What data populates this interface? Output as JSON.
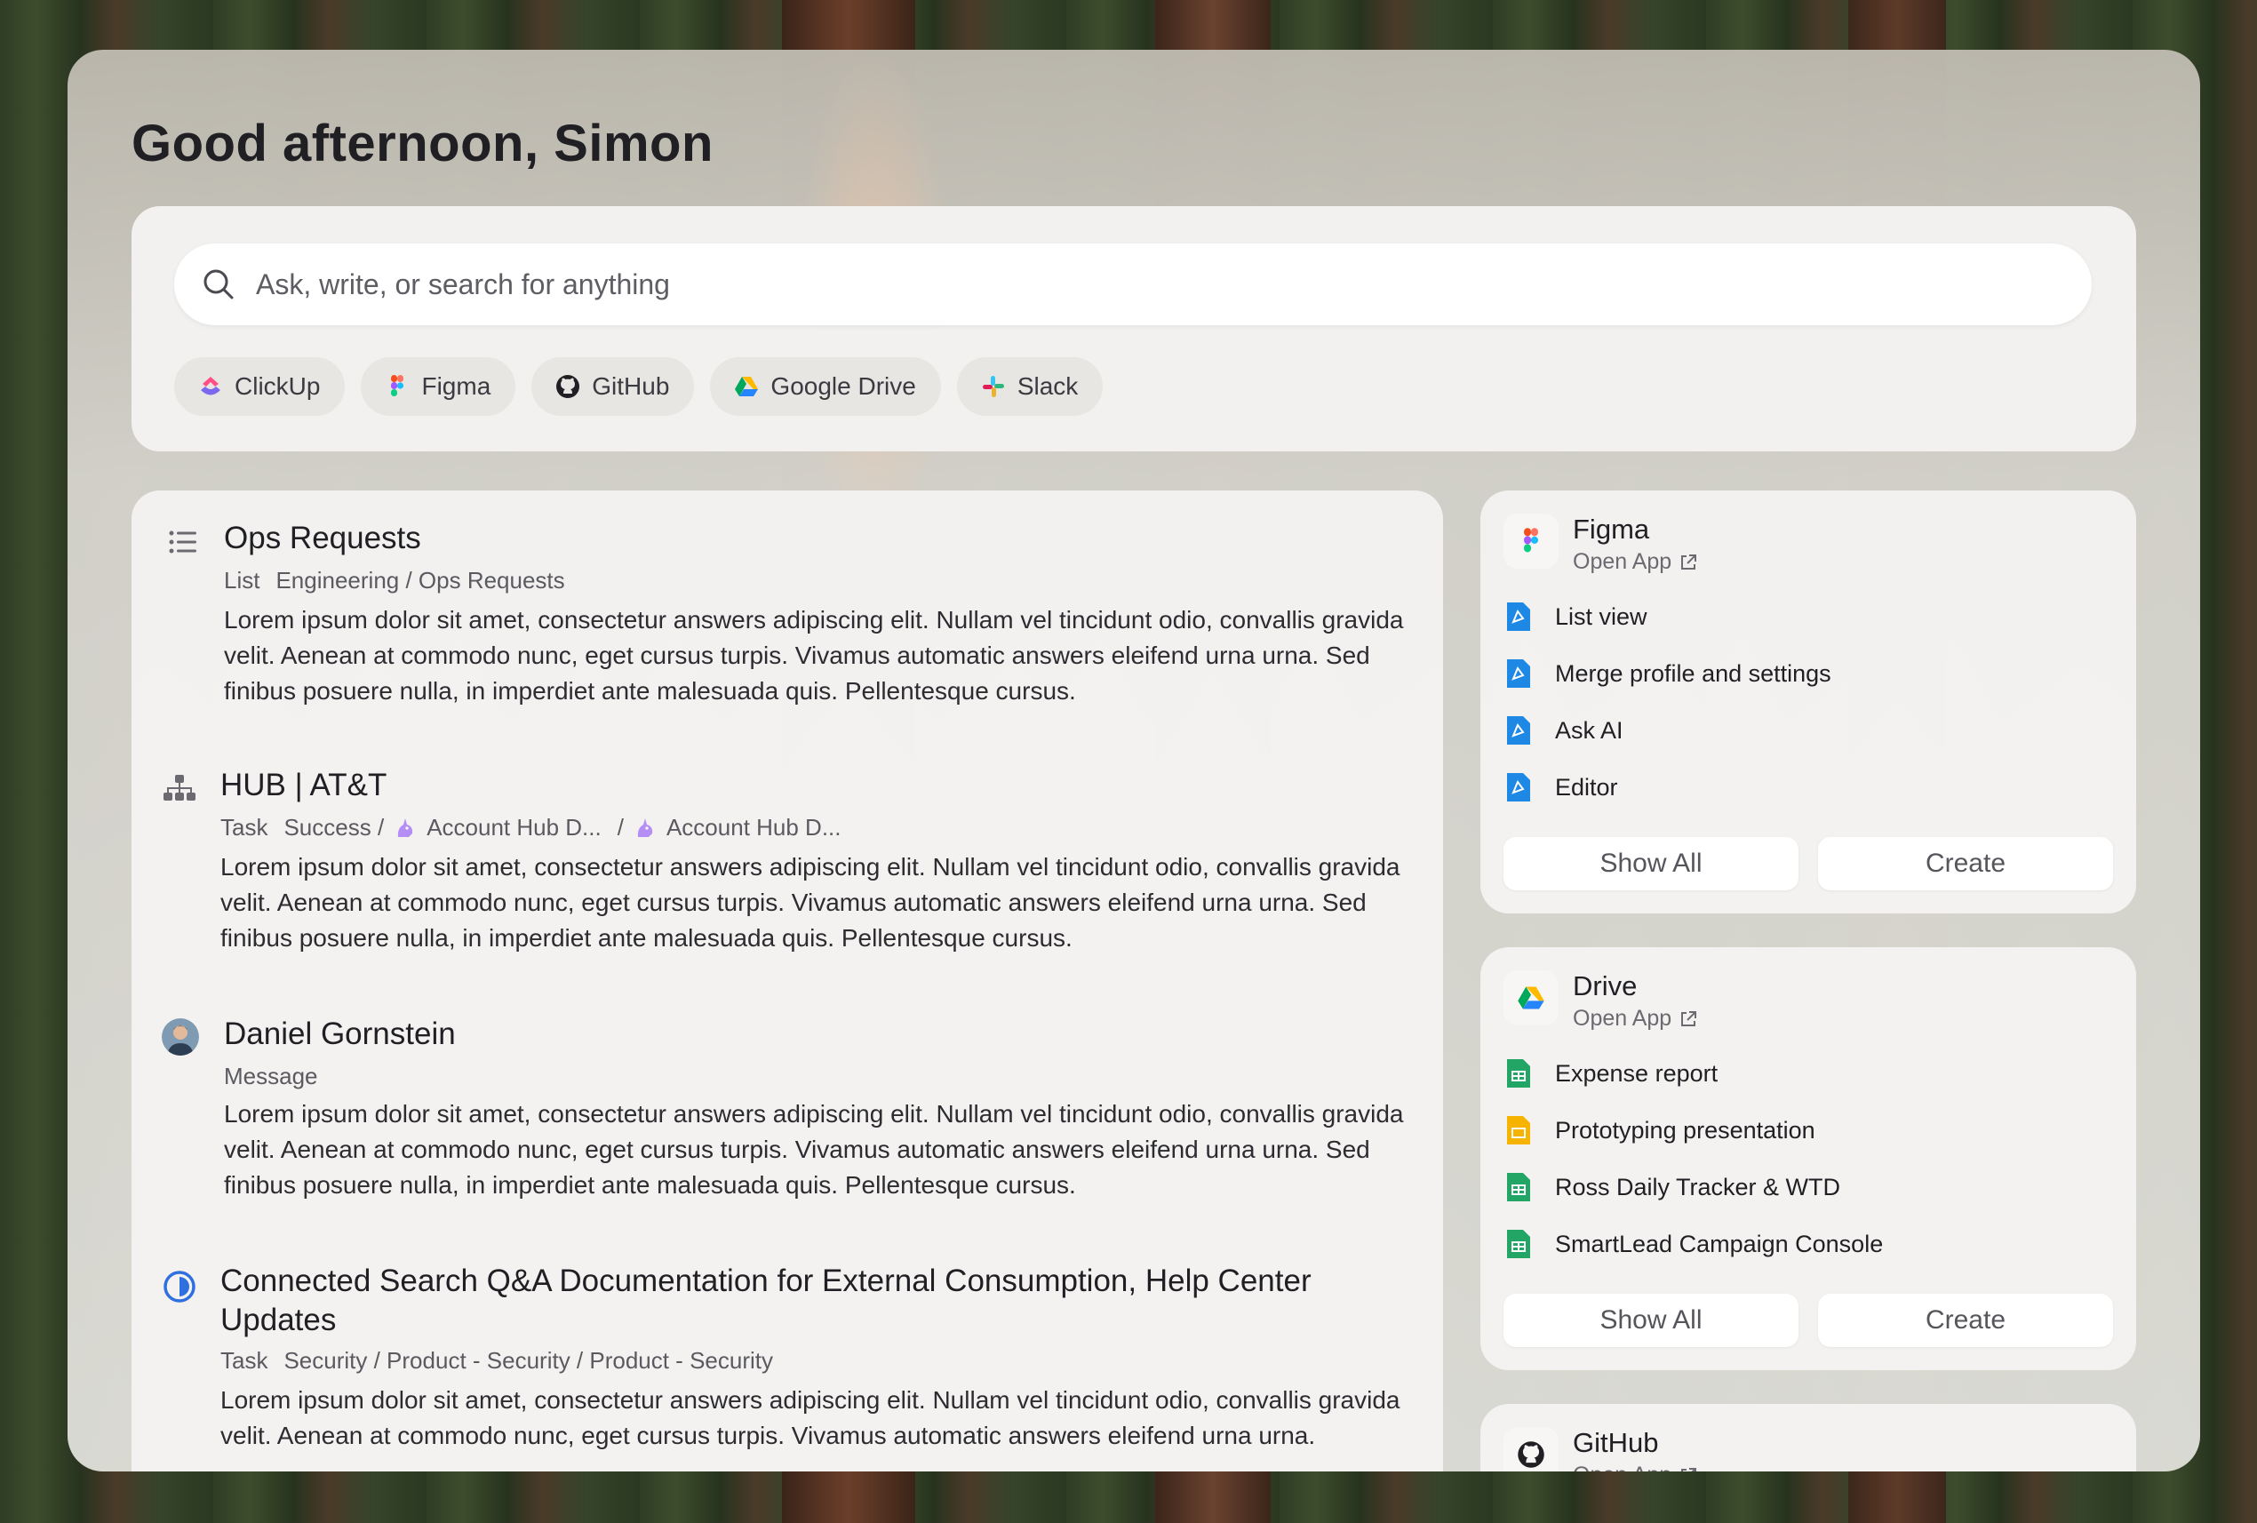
{
  "greeting": "Good afternoon, Simon",
  "search": {
    "placeholder": "Ask, write, or search for anything"
  },
  "chips": [
    {
      "label": "ClickUp",
      "icon": "clickup-icon"
    },
    {
      "label": "Figma",
      "icon": "figma-icon"
    },
    {
      "label": "GitHub",
      "icon": "github-icon"
    },
    {
      "label": "Google Drive",
      "icon": "google-drive-icon"
    },
    {
      "label": "Slack",
      "icon": "slack-icon"
    }
  ],
  "results": [
    {
      "icon": "list-icon",
      "title": "Ops Requests",
      "type": "List",
      "path": "Engineering / Ops Requests",
      "body": "Lorem ipsum dolor sit amet, consectetur answers adipiscing elit. Nullam vel tincidunt odio, convallis gravida velit. Aenean at commodo nunc, eget cursus turpis. Vivamus automatic answers eleifend urna urna. Sed finibus posuere nulla, in imperdiet ante malesuada quis. Pellentesque cursus."
    },
    {
      "icon": "hierarchy-icon",
      "title": "HUB | AT&T",
      "type": "Task",
      "path_start": "Success /",
      "path_a": "Account Hub D...",
      "path_mid": "/",
      "path_b": "Account Hub D...",
      "body": "Lorem ipsum dolor sit amet, consectetur answers adipiscing elit. Nullam vel tincidunt odio, convallis gravida velit. Aenean at commodo nunc, eget cursus turpis. Vivamus automatic answers eleifend urna urna. Sed finibus posuere nulla, in imperdiet ante malesuada quis. Pellentesque cursus."
    },
    {
      "icon": "avatar",
      "title": "Daniel Gornstein",
      "type": "Message",
      "body": "Lorem ipsum dolor sit amet, consectetur answers adipiscing elit. Nullam vel tincidunt odio, convallis gravida velit. Aenean at commodo nunc, eget cursus turpis. Vivamus automatic answers eleifend urna urna. Sed finibus posuere nulla, in imperdiet ante malesuada quis. Pellentesque cursus."
    },
    {
      "icon": "status-in-progress-icon",
      "title_line1": "Connected Search Q&A Documentation for External Consumption, Help Center",
      "title_line2": "Updates",
      "type": "Task",
      "path": "Security / Product - Security / Product - Security",
      "body": "Lorem ipsum dolor sit amet, consectetur answers adipiscing elit. Nullam vel tincidunt odio, convallis gravida velit. Aenean at commodo nunc, eget cursus turpis. Vivamus automatic answers eleifend urna urna."
    }
  ],
  "apps": [
    {
      "name": "Figma",
      "open_label": "Open App",
      "items": [
        "List view",
        "Merge profile and settings",
        "Ask AI",
        "Editor"
      ],
      "show_all": "Show All",
      "create": "Create"
    },
    {
      "name": "Drive",
      "open_label": "Open App",
      "items": [
        "Expense report",
        "Prototyping presentation",
        "Ross Daily Tracker & WTD",
        "SmartLead Campaign Console"
      ],
      "show_all": "Show All",
      "create": "Create"
    },
    {
      "name": "GitHub",
      "open_label": "Open App"
    }
  ],
  "colors": {
    "figma_doc": "#1e88e5",
    "sheets": "#23a566",
    "slides": "#f6b400",
    "status_blue": "#2f6fe0"
  }
}
